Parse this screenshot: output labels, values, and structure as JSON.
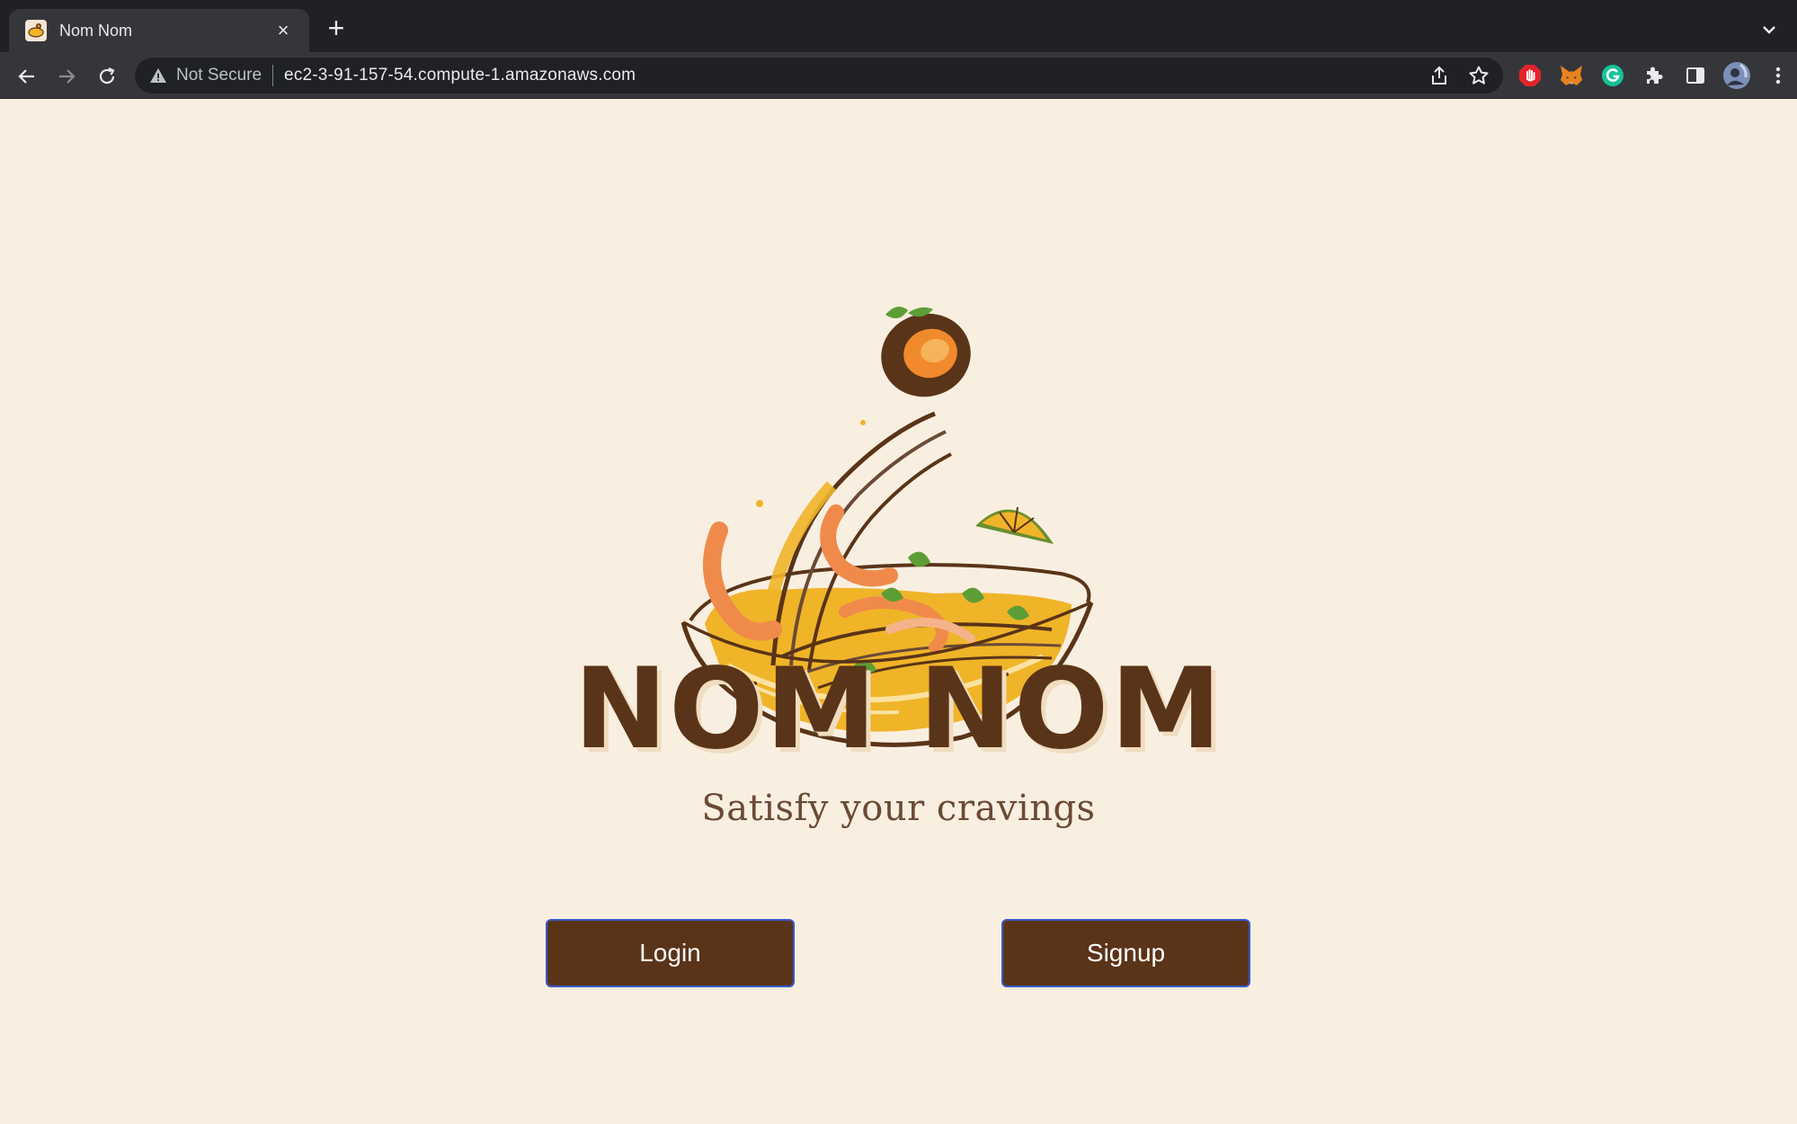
{
  "browser": {
    "tab": {
      "title": "Nom Nom",
      "close_label": "×"
    },
    "new_tab_label": "+",
    "address": {
      "security_label": "Not Secure",
      "url": "ec2-3-91-157-54.compute-1.amazonaws.com"
    },
    "icons": {
      "back": "back-arrow-icon",
      "forward": "forward-arrow-icon",
      "reload": "reload-icon",
      "share": "share-icon",
      "bookmark": "star-icon",
      "extensions": [
        "adblock-hand-icon",
        "metamask-fox-icon",
        "grammarly-icon",
        "puzzle-extensions-icon",
        "side-panel-icon"
      ],
      "profile": "profile-avatar",
      "menu": "kebab-menu-icon"
    }
  },
  "page": {
    "brand": "NOM NOM",
    "tagline": "Satisfy your cravings",
    "buttons": {
      "login": "Login",
      "signup": "Signup"
    },
    "colors": {
      "background": "#f9efe1",
      "brand_brown": "#5a3418",
      "button_bg": "#5a3419",
      "button_border": "#3b57c9",
      "noodle_yellow": "#f0b429",
      "shrimp_orange": "#f08a4b",
      "leaf_green": "#5c9e35"
    }
  }
}
